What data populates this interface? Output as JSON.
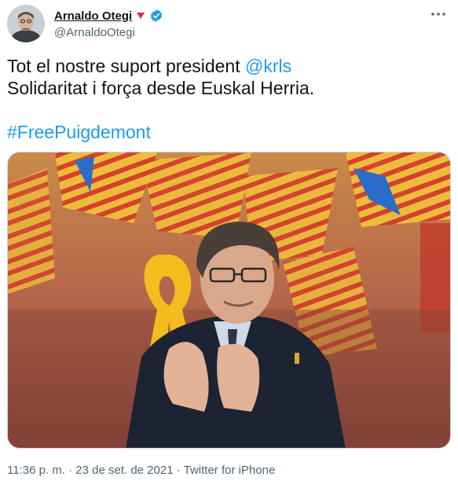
{
  "tweet": {
    "author": {
      "display_name": "Arnaldo Otegi",
      "handle": "@ArnaldoOtegi",
      "avatar_icon": "user-avatar",
      "badge_icon": "verified-badge-icon",
      "flag_icon": "triangle-emoji-icon",
      "colors": {
        "verified": "#1d9bf0",
        "flag": "#e0245e"
      }
    },
    "more_icon": "more-options-icon",
    "text": {
      "line1_prefix": "Tot el nostre suport president ",
      "mention": "@krls",
      "line2": "Solidaritat i força desde Euskal Herria.",
      "hashtag": "#FreePuigdemont"
    },
    "media": {
      "type": "photo"
    },
    "meta": {
      "time": "11:36 p. m.",
      "separator": " · ",
      "date": "23 de set. de 2021",
      "source": "Twitter for iPhone"
    }
  },
  "colors": {
    "link": "#1d9bf0",
    "secondary": "#536471",
    "text": "#0f1419"
  }
}
